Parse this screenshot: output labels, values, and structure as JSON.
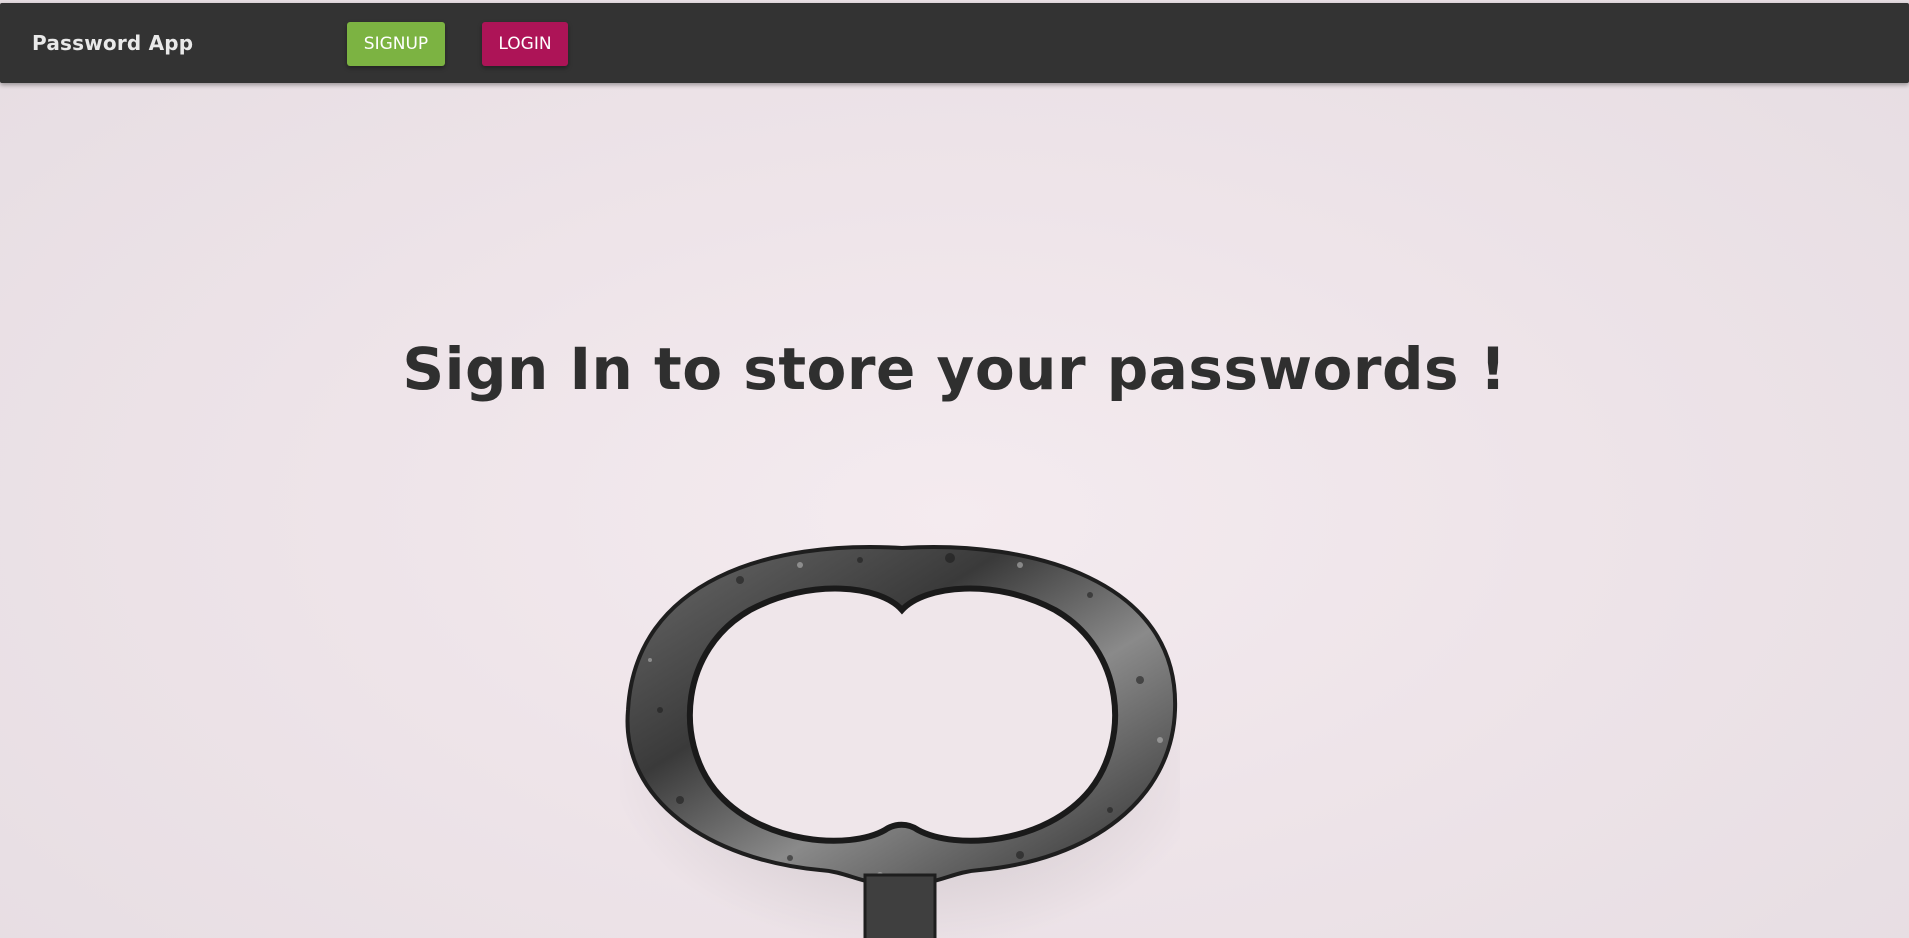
{
  "navbar": {
    "brand": "Password App",
    "signup_label": "SIGNUP",
    "login_label": "LOGIN"
  },
  "hero": {
    "headline": "Sign In to store your passwords !",
    "image_icon": "antique-key-icon"
  },
  "colors": {
    "navbar_bg": "#333333",
    "signup_bg": "#7cb342",
    "login_bg": "#ad1457",
    "headline": "#2f2f2f",
    "page_bg": "#efe6ea"
  }
}
